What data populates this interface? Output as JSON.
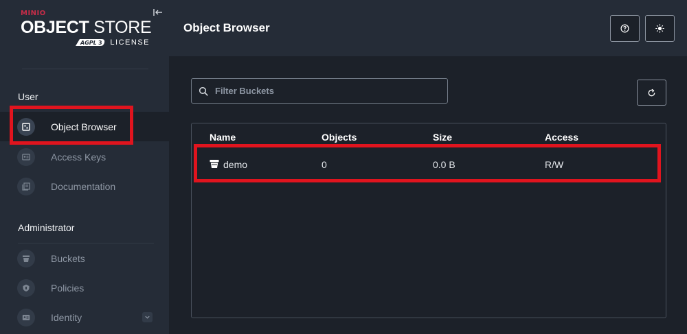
{
  "brand": {
    "minio": "MINIO",
    "title_bold": "OBJECT",
    "title_light": "STORE",
    "badge": "AGPL v3",
    "license": "LICENSE"
  },
  "sidebar": {
    "sections": [
      {
        "label": "User",
        "items": [
          {
            "label": "Object Browser",
            "icon": "object-browser-icon",
            "active": true
          },
          {
            "label": "Access Keys",
            "icon": "access-keys-icon",
            "active": false
          },
          {
            "label": "Documentation",
            "icon": "documentation-icon",
            "active": false
          }
        ]
      },
      {
        "label": "Administrator",
        "items": [
          {
            "label": "Buckets",
            "icon": "bucket-icon",
            "active": false
          },
          {
            "label": "Policies",
            "icon": "policy-icon",
            "active": false
          },
          {
            "label": "Identity",
            "icon": "identity-icon",
            "active": false,
            "expandable": true
          }
        ]
      }
    ]
  },
  "header": {
    "title": "Object Browser",
    "buttons": [
      "help-icon",
      "theme-toggle-icon"
    ]
  },
  "main": {
    "search": {
      "placeholder": "Filter Buckets",
      "value": ""
    },
    "table": {
      "columns": [
        "Name",
        "Objects",
        "Size",
        "Access"
      ],
      "rows": [
        {
          "name": "demo",
          "objects": "0",
          "size": "0.0 B",
          "access": "R/W"
        }
      ]
    }
  },
  "colors": {
    "sidebar_bg": "#252c37",
    "main_bg": "#1c2129",
    "brand_accent": "#c72c48",
    "highlight": "#e0141e"
  }
}
